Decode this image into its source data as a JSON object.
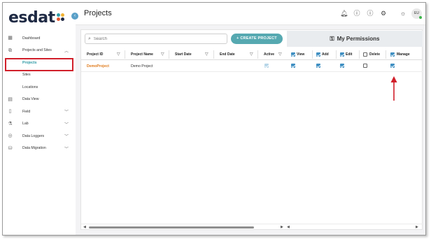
{
  "app": {
    "logo_text": "esdat",
    "logo_dot_colors": [
      "#2c9aa6",
      "#f2b233",
      "#e4562f",
      "#1f2a44"
    ]
  },
  "header": {
    "title": "Projects",
    "icons": [
      "bell-icon",
      "help-icon",
      "info-icon",
      "settings-icon",
      "theme-icon"
    ],
    "avatar": "EU"
  },
  "sidebar": {
    "items": [
      {
        "label": "Dashboard",
        "icon": "dashboard-icon"
      },
      {
        "label": "Projects and Sites",
        "icon": "map-icon",
        "expanded": true
      },
      {
        "label": "Projects",
        "sub": true,
        "active": true
      },
      {
        "label": "Sites",
        "sub": true
      },
      {
        "label": "Locations",
        "sub": true
      },
      {
        "label": "Data View",
        "icon": "table-icon"
      },
      {
        "label": "Field",
        "icon": "phone-icon",
        "chevron": true
      },
      {
        "label": "Lab",
        "icon": "flask-icon",
        "chevron": true
      },
      {
        "label": "Data Loggers",
        "icon": "logger-icon",
        "chevron": true
      },
      {
        "label": "Data Migration",
        "icon": "migration-icon",
        "chevron": true
      }
    ]
  },
  "toolbar": {
    "search_placeholder": "Search",
    "create_label": "CREATE PROJECT",
    "create_prefix": "+"
  },
  "permissions": {
    "title": "My Permissions",
    "columns": [
      {
        "label": "View",
        "checked": true
      },
      {
        "label": "Add",
        "checked": true
      },
      {
        "label": "Edit",
        "checked": true
      },
      {
        "label": "Delete",
        "checked": false
      },
      {
        "label": "Manage",
        "checked": true
      }
    ]
  },
  "table": {
    "columns": [
      "Project ID",
      "Project Name",
      "Start Date",
      "End Date",
      "Active"
    ],
    "rows": [
      {
        "project_id": "DemoProject",
        "project_name": "Demo Project",
        "start_date": "",
        "end_date": "",
        "active": true,
        "perms": [
          true,
          true,
          true,
          false,
          true
        ]
      }
    ]
  },
  "colors": {
    "accent": "#56a9b1",
    "link": "#e07b1c",
    "highlight": "#d11f2a",
    "checkbox": "#3f8fc2"
  }
}
